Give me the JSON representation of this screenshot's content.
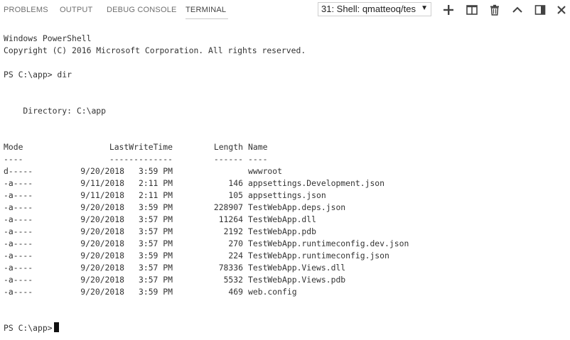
{
  "tabs": {
    "problems": "PROBLEMS",
    "output": "OUTPUT",
    "debug_console": "DEBUG CONSOLE",
    "terminal": "TERMINAL"
  },
  "shell_select": {
    "value": "31: Shell: qmatteoq/tes",
    "arrow": "▼"
  },
  "actions": {
    "new_terminal": "plus-icon",
    "split_terminal": "split-icon",
    "kill_terminal": "trash-icon",
    "maximize_panel": "chevron-up-icon",
    "toggle_panel": "panel-icon",
    "close_panel": "close-icon"
  },
  "terminal": {
    "line1": "Windows PowerShell",
    "line2": "Copyright (C) 2016 Microsoft Corporation. All rights reserved.",
    "command": "PS C:\\app> dir",
    "directory": "    Directory: C:\\app",
    "headers": {
      "mode": "Mode",
      "lastwritetime": "LastWriteTime",
      "length": "Length",
      "name": "Name"
    },
    "separators": {
      "mode": "----",
      "lastwritetime": "-------------",
      "length": "------",
      "name": "----"
    },
    "entries": [
      {
        "mode": "d-----",
        "date": "9/20/2018",
        "time": "3:59 PM",
        "length": "",
        "name": "wwwroot"
      },
      {
        "mode": "-a----",
        "date": "9/11/2018",
        "time": "2:11 PM",
        "length": "146",
        "name": "appsettings.Development.json"
      },
      {
        "mode": "-a----",
        "date": "9/11/2018",
        "time": "2:11 PM",
        "length": "105",
        "name": "appsettings.json"
      },
      {
        "mode": "-a----",
        "date": "9/20/2018",
        "time": "3:59 PM",
        "length": "228907",
        "name": "TestWebApp.deps.json"
      },
      {
        "mode": "-a----",
        "date": "9/20/2018",
        "time": "3:57 PM",
        "length": "11264",
        "name": "TestWebApp.dll"
      },
      {
        "mode": "-a----",
        "date": "9/20/2018",
        "time": "3:57 PM",
        "length": "2192",
        "name": "TestWebApp.pdb"
      },
      {
        "mode": "-a----",
        "date": "9/20/2018",
        "time": "3:57 PM",
        "length": "270",
        "name": "TestWebApp.runtimeconfig.dev.json"
      },
      {
        "mode": "-a----",
        "date": "9/20/2018",
        "time": "3:59 PM",
        "length": "224",
        "name": "TestWebApp.runtimeconfig.json"
      },
      {
        "mode": "-a----",
        "date": "9/20/2018",
        "time": "3:57 PM",
        "length": "78336",
        "name": "TestWebApp.Views.dll"
      },
      {
        "mode": "-a----",
        "date": "9/20/2018",
        "time": "3:57 PM",
        "length": "5532",
        "name": "TestWebApp.Views.pdb"
      },
      {
        "mode": "-a----",
        "date": "9/20/2018",
        "time": "3:59 PM",
        "length": "469",
        "name": "web.config"
      }
    ],
    "prompt": "PS C:\\app>"
  }
}
